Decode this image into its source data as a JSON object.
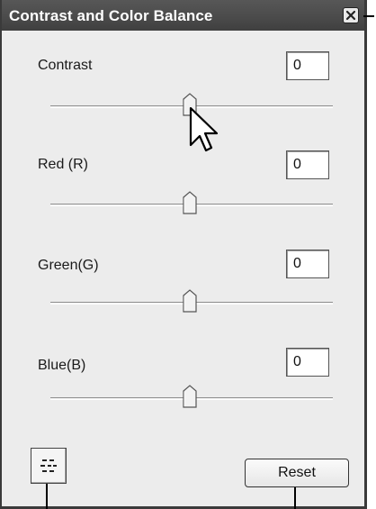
{
  "window": {
    "title": "Contrast and Color Balance"
  },
  "sliders": [
    {
      "label": "Contrast",
      "value": "0",
      "level": 0.5
    },
    {
      "label": "Red (R)",
      "value": "0",
      "level": 0.5
    },
    {
      "label": "Green(G)",
      "value": "0",
      "level": 0.5
    },
    {
      "label": "Blue(B)",
      "value": "0",
      "level": 0.5
    }
  ],
  "buttons": {
    "reset_label": "Reset"
  },
  "icons": {
    "close": "close-icon",
    "toggle": "dash-toggle-icon",
    "cursor": "mouse-pointer-icon"
  }
}
